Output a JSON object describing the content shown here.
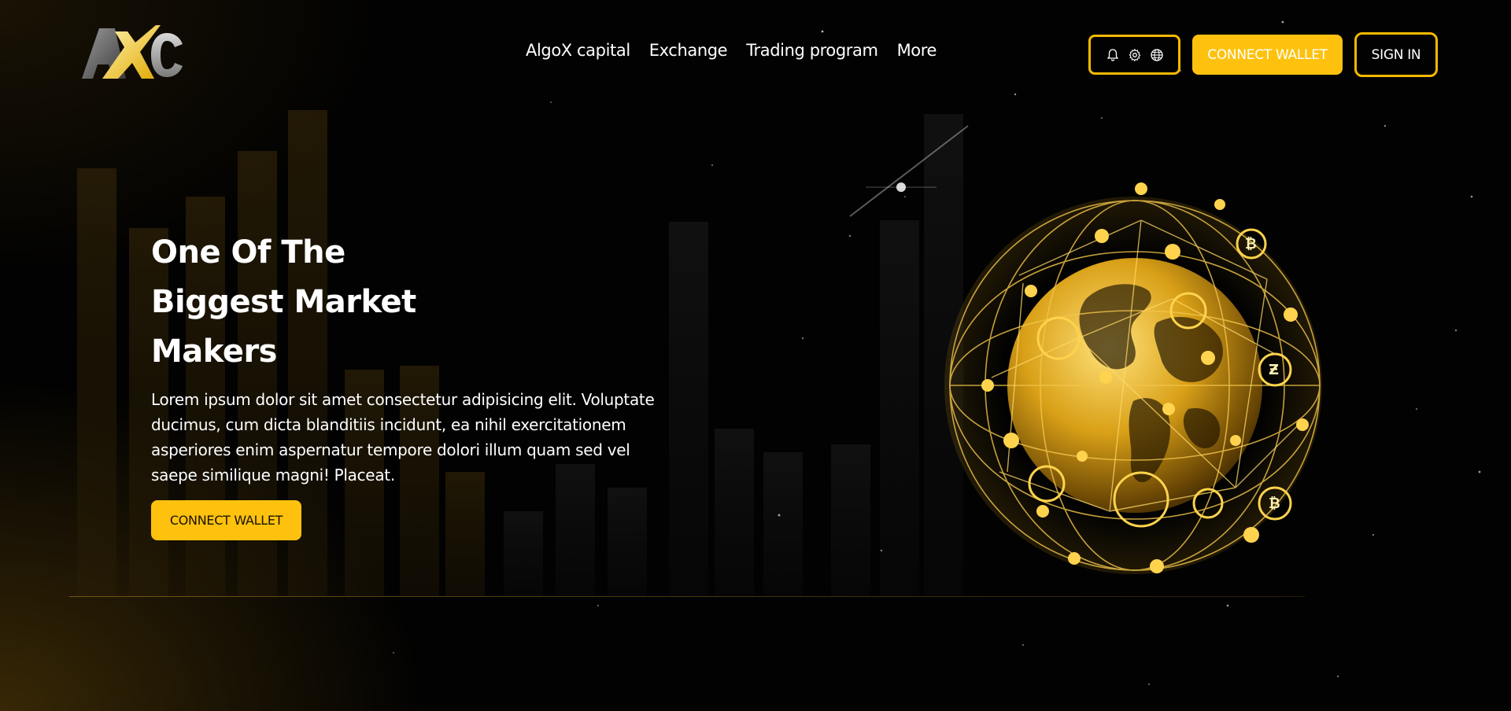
{
  "brand": {
    "logo_text": "AXC",
    "accent": "#fec20e",
    "border": "#f5b800",
    "background": "#020202"
  },
  "nav": {
    "items": [
      {
        "label": "AlgoX capital"
      },
      {
        "label": "Exchange"
      },
      {
        "label": "Trading program"
      },
      {
        "label": "More"
      }
    ]
  },
  "header": {
    "icons": [
      "bell-icon",
      "gear-icon",
      "globe-icon"
    ],
    "connect_label": "CONNECT WALLET",
    "signin_label": "SIGN IN"
  },
  "hero": {
    "title_lines": [
      "One Of The",
      "Biggest Market",
      "Makers"
    ],
    "text": "Lorem ipsum dolor sit amet consectetur adipisicing elit. Voluptate ducimus, cum dicta blanditiis incidunt, ea nihil exercitationem asperiores enim aspernatur tempore dolori illum quam sed vel saepe similique magni! Placeat.",
    "cta_label": "CONNECT WALLET"
  },
  "visual": {
    "globe": "crypto-network-globe"
  }
}
